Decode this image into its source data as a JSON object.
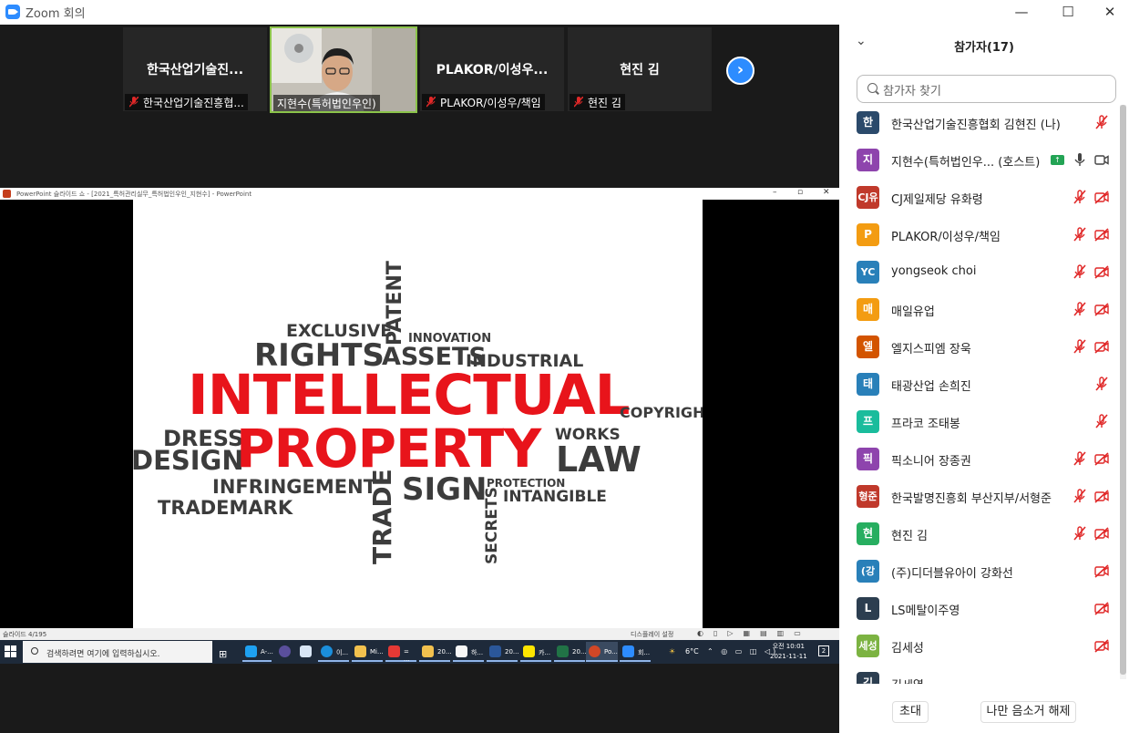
{
  "window": {
    "title": "Zoom 회의",
    "controls": [
      "—",
      "☐",
      "✕"
    ]
  },
  "gallery": {
    "tiles": [
      {
        "name": "한국산업기술진...",
        "label": "한국산업기술진흥협...",
        "muted": true
      },
      {
        "name": "",
        "label": "지현수(특허법인우인)",
        "muted": false,
        "video": true
      },
      {
        "name": "PLAKOR/이성우...",
        "label": "PLAKOR/이성우/책임",
        "muted": true
      },
      {
        "name": "현진 김",
        "label": "현진 김",
        "muted": true
      }
    ],
    "next_icon": "chevron-right-icon"
  },
  "powerpoint": {
    "window_title": "PowerPoint 슬라이드 쇼 - [2021_특허관리실무_특허법인우인_지현수] - PowerPoint",
    "slide_counter": "슬라이드 4/195",
    "display_settings": "디스플레이 설정",
    "words": {
      "intellectual": "INTELLECTUAL",
      "property": "PROPERTY",
      "rights": "RIGHTS",
      "exclusive": "EXCLUSIVE",
      "patent": "PATENT",
      "innovation": "INNOVATION",
      "assets": "ASSETS",
      "industrial": "INDUSTRIAL",
      "copyright": "COPYRIGHT",
      "dress": "DRESS",
      "design": "DESIGN",
      "works": "WORKS",
      "law": "LAW",
      "infringement": "INFRINGEMENT",
      "sign": "SIGN",
      "protection": "PROTECTION",
      "intangible": "INTANGIBLE",
      "trademark": "TRADEMARK",
      "trade": "TRADE",
      "secrets": "SECRETS"
    },
    "colors": {
      "red": "#e8141b",
      "gray": "#3c3c3c"
    }
  },
  "taskbar": {
    "search_placeholder": "검색하려면 여기에 입력하십시오.",
    "apps": [
      "A-...",
      "이...",
      "Mi...",
      "= ...",
      "20...",
      "하...",
      "20...",
      "카...",
      "20...",
      "Po...",
      "회..."
    ],
    "weather": "6°C",
    "clock_time": "오전 10:01",
    "clock_date": "2021-11-11",
    "notification_count": "2"
  },
  "participants": {
    "title": "참가자(17)",
    "search_placeholder": "참가자 찾기",
    "list": [
      {
        "initials": "한",
        "name": "한국산업기술진흥협회 김현진 (나)",
        "color": "#2b4a6b",
        "mic": "muted",
        "video": "none"
      },
      {
        "initials": "지",
        "name": "지현수(특허법인우...  (호스트)",
        "color": "#8e44ad",
        "mic": "on",
        "video": "on",
        "host": true
      },
      {
        "initials": "CJ유",
        "name": "CJ제일제당 유화령",
        "color": "#c0392b",
        "mic": "muted",
        "video": "off"
      },
      {
        "initials": "P",
        "name": "PLAKOR/이성우/책임",
        "color": "#f39c12",
        "mic": "muted",
        "video": "off"
      },
      {
        "initials": "YC",
        "name": "yongseok choi",
        "color": "#2980b9",
        "mic": "muted",
        "video": "off"
      },
      {
        "initials": "매",
        "name": "매일유업",
        "color": "#f39c12",
        "mic": "muted",
        "video": "off"
      },
      {
        "initials": "엘",
        "name": "엘지스피엠 장욱",
        "color": "#d35400",
        "mic": "muted",
        "video": "off"
      },
      {
        "initials": "태",
        "name": "태광산업 손희진",
        "color": "#2980b9",
        "mic": "muted",
        "video": "none"
      },
      {
        "initials": "프",
        "name": "프라코 조태봉",
        "color": "#1abc9c",
        "mic": "muted",
        "video": "none"
      },
      {
        "initials": "픽",
        "name": "픽소니어 장종권",
        "color": "#8e44ad",
        "mic": "muted",
        "video": "off"
      },
      {
        "initials": "형준",
        "name": "한국발명진흥회 부산지부/서형준",
        "color": "#c0392b",
        "mic": "muted",
        "video": "off"
      },
      {
        "initials": "현",
        "name": "현진 김",
        "color": "#27ae60",
        "mic": "muted",
        "video": "off"
      },
      {
        "initials": "(강",
        "name": "(주)디더블유아이 강화선",
        "color": "#2980b9",
        "mic": "none",
        "video": "off"
      },
      {
        "initials": "L",
        "name": "LS메탈이주영",
        "color": "#2c3e50",
        "mic": "none",
        "video": "off"
      },
      {
        "initials": "세성",
        "name": "김세성",
        "color": "#7cb342",
        "mic": "none",
        "video": "off"
      },
      {
        "initials": "김",
        "name": "김세열",
        "color": "#2c3e50",
        "mic": "none",
        "video": "none"
      }
    ],
    "invite_label": "초대",
    "unmute_me_label": "나만 음소거 해제"
  }
}
